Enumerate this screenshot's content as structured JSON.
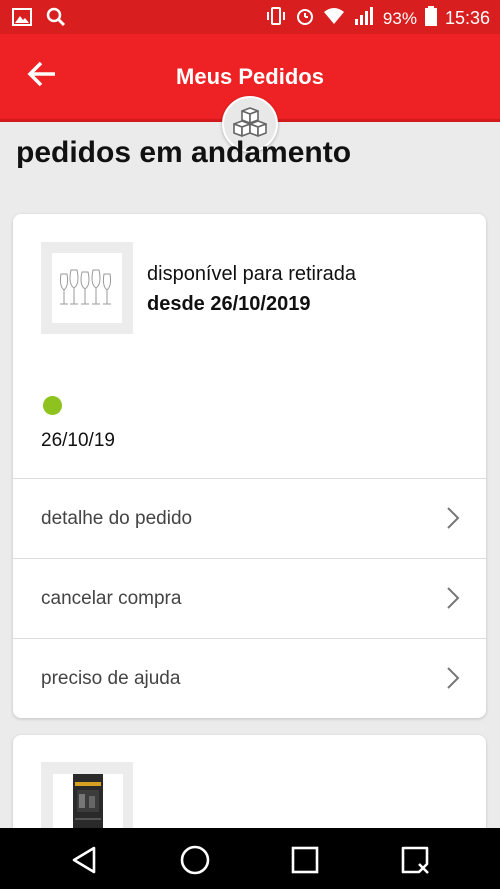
{
  "status_bar": {
    "battery": "93%",
    "time": "15:36",
    "network": "4G"
  },
  "app_bar": {
    "title": "Meus Pedidos"
  },
  "section": {
    "title": "pedidos em andamento"
  },
  "orders": [
    {
      "status_text": "disponível para retirada",
      "status_date": "desde 26/10/2019",
      "order_date": "26/10/19",
      "status_color": "#8dc21f",
      "actions": [
        {
          "label": "detalhe do pedido"
        },
        {
          "label": "cancelar compra"
        },
        {
          "label": "preciso de ajuda"
        }
      ]
    }
  ],
  "colors": {
    "primary_red": "#ee2224",
    "status_bar_red": "#d81e1e",
    "background": "#ebebeb",
    "status_green": "#8dc21f"
  }
}
